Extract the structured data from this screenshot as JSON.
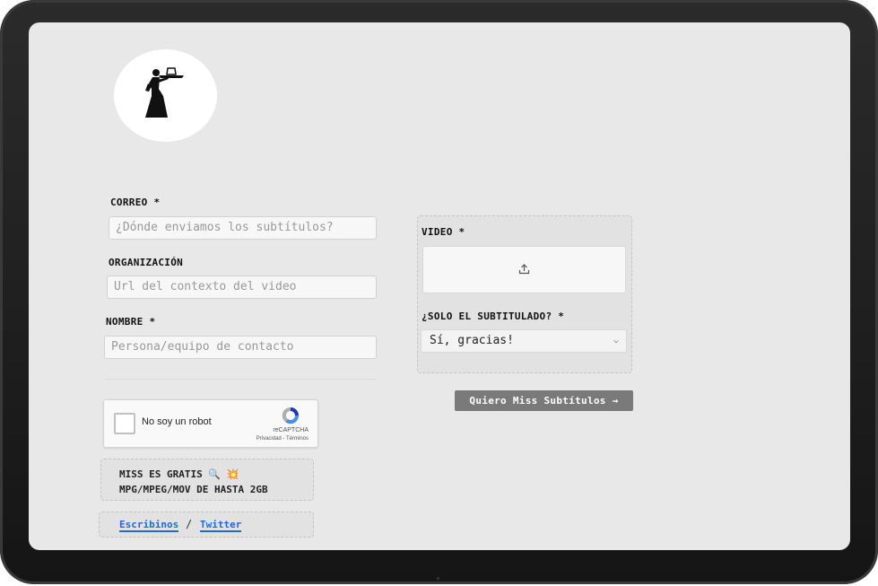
{
  "form": {
    "email": {
      "label": "CORREO *",
      "placeholder": "¿Dónde enviamos los subtítulos?"
    },
    "organization": {
      "label": "ORGANIZACIÓN",
      "placeholder": "Url del contexto del video"
    },
    "name": {
      "label": "NOMBRE *",
      "placeholder": "Persona/equipo de contacto"
    }
  },
  "captcha": {
    "label": "No soy un robot",
    "brand": "reCAPTCHA",
    "terms": "Privacidad - Términos"
  },
  "info": {
    "line1": "MISS ES GRATIS 🔍 💥",
    "line2": "MPG/MPEG/MOV DE HASTA 2GB"
  },
  "links": {
    "write": "Escribinos",
    "separator": "/",
    "twitter": "Twitter"
  },
  "video_panel": {
    "video_label": "VIDEO *",
    "subtitle_only_label": "¿SOLO EL SUBTITULADO? *",
    "subtitle_only_value": "Sí, gracias!"
  },
  "submit": {
    "label": "Quiero Miss Subtítulos →"
  },
  "icons": {
    "upload": "upload-icon",
    "chevron": "chevron-down-icon",
    "logo": "waitress-logo-icon"
  }
}
